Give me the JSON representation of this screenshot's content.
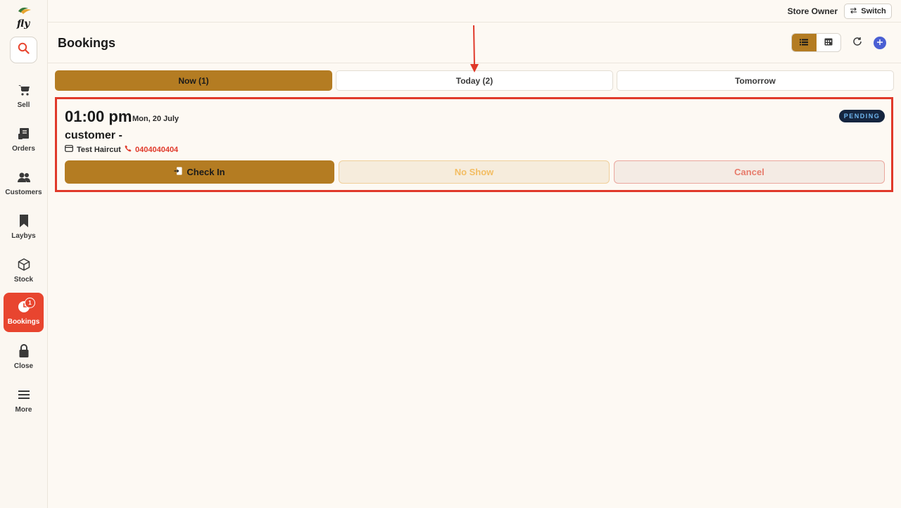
{
  "topbar": {
    "user_role": "Store Owner",
    "switch_label": "Switch"
  },
  "sidebar": {
    "logo_text": "fly",
    "items": [
      {
        "label": "Sell",
        "icon": "cart-icon"
      },
      {
        "label": "Orders",
        "icon": "receipt-icon"
      },
      {
        "label": "Customers",
        "icon": "users-icon"
      },
      {
        "label": "Laybys",
        "icon": "bookmark-icon"
      },
      {
        "label": "Stock",
        "icon": "box-icon"
      },
      {
        "label": "Bookings",
        "icon": "clock-icon",
        "active": true,
        "badge": "1"
      },
      {
        "label": "Close",
        "icon": "lock-icon"
      },
      {
        "label": "More",
        "icon": "menu-icon"
      }
    ]
  },
  "header": {
    "title": "Bookings"
  },
  "tabs": [
    {
      "label": "Now (1)",
      "active": true
    },
    {
      "label": "Today (2)",
      "active": false
    },
    {
      "label": "Tomorrow",
      "active": false
    }
  ],
  "booking": {
    "time": "01:00 pm",
    "date": "Mon, 20 July",
    "customer": "customer -",
    "service": "Test Haircut",
    "phone": "0404040404",
    "status": "PENDING",
    "actions": {
      "check_in": "Check In",
      "no_show": "No Show",
      "cancel": "Cancel"
    }
  },
  "colors": {
    "accent": "#b47c22",
    "active_nav": "#e8452f",
    "highlight_border": "#e0392a",
    "status_bg": "#15253f",
    "add_button": "#4a5fd3"
  }
}
